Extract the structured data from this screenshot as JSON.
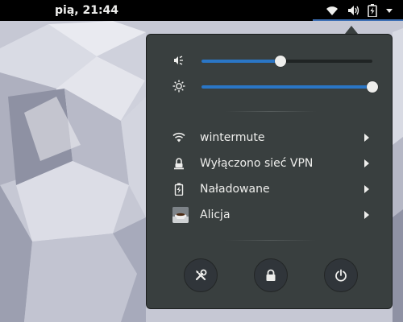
{
  "topbar": {
    "clock": "pią, 21:44",
    "status_icons": [
      "wifi-icon",
      "volume-icon",
      "battery-icon",
      "menu-arrow-icon"
    ]
  },
  "menu": {
    "volume": {
      "icon": "volume-low-icon",
      "level": 0.46
    },
    "brightness": {
      "icon": "brightness-icon",
      "level": 1.0
    },
    "items": [
      {
        "icon": "wifi-icon",
        "label": "wintermute"
      },
      {
        "icon": "vpn-icon",
        "label": "Wyłączono sieć VPN"
      },
      {
        "icon": "battery-icon",
        "label": "Naładowane"
      },
      {
        "icon": "user-avatar",
        "label": "Alicja"
      }
    ],
    "buttons": [
      "settings-icon",
      "lock-icon",
      "power-icon"
    ]
  },
  "colors": {
    "topbar": "#000000",
    "menu_bg": "#393f3f",
    "accent": "#2a76c6",
    "text": "#eeeeec"
  }
}
